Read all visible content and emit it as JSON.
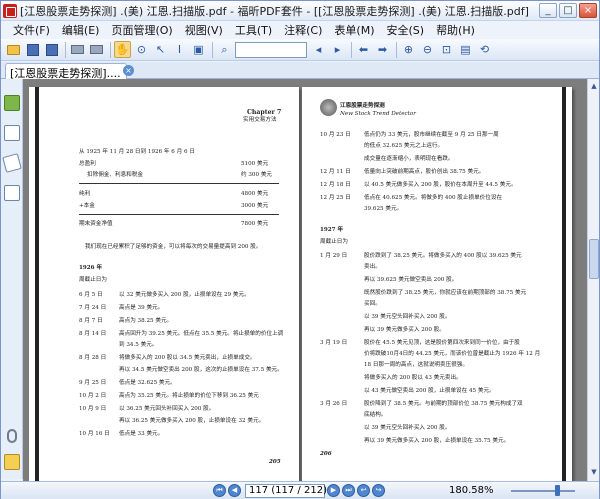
{
  "window": {
    "title": "[江恩股票走势探测] .(美) 江恩.扫描版.pdf - 福昕PDF套件 - [[江恩股票走势探测] .(美) 江恩.扫描版.pdf]",
    "minimize": "_",
    "maximize": "□",
    "close": "×"
  },
  "menu": [
    "文件(F)",
    "编辑(E)",
    "页面管理(O)",
    "视图(V)",
    "工具(T)",
    "注释(C)",
    "表单(M)",
    "安全(S)",
    "帮助(H)"
  ],
  "tab": {
    "label": "[江恩股票走势探测]....",
    "close": "×"
  },
  "status": {
    "page": "117 (117 / 212)",
    "zoom": "180.58%"
  },
  "left_page": {
    "chapter": "Chapter 7",
    "chapter_sub": "实用交易方法",
    "period": "从 1925 年 11 月 28 日到 1926 年 6 月 6 日",
    "summary": [
      [
        "总盈利",
        "5100 美元"
      ],
      [
        "扣除佣金、利息和税金",
        "约 300 美元"
      ],
      [
        "纯利",
        "4800 美元"
      ],
      [
        "+本金",
        "3000 美元"
      ],
      [
        "期末资金净值",
        "7800 美元"
      ]
    ],
    "note": "我们现在已经累积了足够的资金，可以将每次的交易量提高到 200 股。",
    "year": "1926 年",
    "weekly": "周截止日为",
    "entries": [
      [
        "6 月 5 日",
        "以 32 美元做多买入 200 股，止损单设在 29 美元。"
      ],
      [
        "7 月 24 日",
        "高点是 39 美元。"
      ],
      [
        "8 月 7 日",
        "高点为 38.25 美元。"
      ],
      [
        "8 月 14 日",
        "高点回升为 39.25 美元。低点在 35.5 美元。将止损单的价位上调"
      ],
      [
        "",
        "到 34.5 美元。"
      ],
      [
        "8 月 28 日",
        "将做多买入的 200 股以 34.5 美元卖出，止损单成交。"
      ],
      [
        "",
        "再以 34.5 美元做空卖出 200 股，这次的止损单设在 37.5 美元。"
      ],
      [
        "9 月 25 日",
        "低点是 32.625 美元。"
      ],
      [
        "10 月 2 日",
        "高点为 35.25 美元。将止损单的价位下移到 36.25 美元"
      ],
      [
        "10 月 9 日",
        "以 36.25 美元回头补回买入 200 股。"
      ],
      [
        "",
        "再以 36.25 美元做多买入 200 股，止损单设在 32 美元。"
      ],
      [
        "10 月 16 日",
        "低点是 33 美元。"
      ]
    ],
    "page_no": "205"
  },
  "right_page": {
    "header_cn": "江恩股票走势探测",
    "header_en": "New Stock Trend Detector",
    "entries": [
      [
        "10 月 23 日",
        "低点仍为 33 美元，股市继续在截至 9 月 25 日那一周"
      ],
      [
        "",
        "的低点 32.625 美元之上运行。"
      ],
      [
        "",
        "成交量在逐渐缩小，表明现在看跌。"
      ],
      [
        "12 月 11 日",
        "低量向上突破前期高点，股价创出 38.75 美元。"
      ],
      [
        "12 月 18 日",
        "以 40.5 美元做多买入 200 股，股价在本周升至 44.5 美元。"
      ],
      [
        "12 月 25 日",
        "低点在 40.625 美元。将做多的 400 股止损单价位设在"
      ],
      [
        "",
        "39.625 美元。"
      ],
      [
        "1927 年",
        ""
      ],
      [
        "周截止日为",
        ""
      ],
      [
        "1 月 29 日",
        "股价跌到了 38.25 美元。将做多买入的 400 股以 39.625 美元"
      ],
      [
        "",
        "卖出。"
      ],
      [
        "",
        "再以 39.625 美元做空卖出 200 股。"
      ],
      [
        "",
        "既然股价跌到了 38.25 美元，你就应该在前期顶部的 38.75 美元"
      ],
      [
        "",
        "买回。"
      ],
      [
        "",
        "以 39 美元空头回补买入 200 股。"
      ],
      [
        "",
        "再以 39 美元做多买入 200 股。"
      ],
      [
        "3 月 19 日",
        "股价在 45.5 美元见顶，这是股价第四次来到同一价位，由于股"
      ],
      [
        "",
        "价将跌破10月4日的 44.25 美元，而该价位曾是截止为 1926 年 12 月"
      ],
      [
        "",
        "18 日那一周的高点，这就说明卖压很强。"
      ],
      [
        "",
        "将做多买入的 200 股以 43 美元卖出。"
      ],
      [
        "",
        "以 43 美元做空卖出 200 股，止损单设在 45 美元。"
      ],
      [
        "3 月 26 日",
        "股价降到了 38.5 美元。与前期的顶部价位 38.75 美元构成了双"
      ],
      [
        "",
        "底结构。"
      ],
      [
        "",
        "以 39 美元空头回补买入 200 股。"
      ],
      [
        "",
        "再以 39 美元做多买入 200 股，止损单设在 35.75 美元。"
      ]
    ],
    "page_no": "206"
  },
  "icons": {
    "toolbar": [
      "open-icon",
      "save-icon",
      "save-as-icon",
      "print-icon",
      "screen-icon",
      "hand-icon",
      "zoom-icon",
      "select-icon",
      "text-select-icon",
      "snapshot-icon",
      "find-icon",
      "previous-icon",
      "next-icon",
      "back-icon",
      "forward-icon",
      "zoom-in-icon",
      "zoom-out-icon",
      "zoom-fit-icon",
      "page-icon",
      "rotate-icon"
    ]
  }
}
